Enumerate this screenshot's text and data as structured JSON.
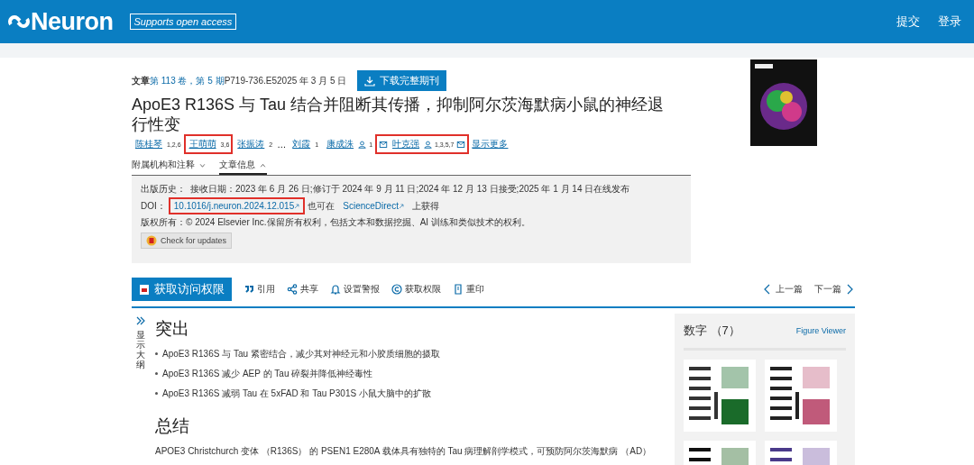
{
  "header": {
    "logo": "Neuron",
    "badge": "Supports open access",
    "actions": [
      "提交",
      "登录"
    ]
  },
  "article": {
    "meta_label": "文章",
    "meta_issue": "第 113 卷，第 5 期",
    "meta_pages": "P719-736.E52025 年 3 月 5 日",
    "download": "下载完整期刊",
    "title": "ApoE3 R136S 与 Tau 结合并阻断其传播，抑制阿尔茨海默病小鼠的神经退行性变",
    "authors": [
      {
        "name": "陈桂琴",
        "sup": "1,2,6",
        "highlighted": false,
        "person": false,
        "mail_before": false,
        "mail_after": false
      },
      {
        "name": "王萌萌",
        "sup": "3,6",
        "highlighted": true,
        "person": false,
        "mail_before": false,
        "mail_after": false
      },
      {
        "name": "张振涛",
        "sup": "2",
        "highlighted": false,
        "person": false,
        "mail_before": false,
        "mail_after": false
      },
      {
        "name": "刘霞",
        "sup": "1",
        "highlighted": false,
        "person": false,
        "mail_before": false,
        "mail_after": false,
        "ellipsis_before": "…"
      },
      {
        "name": "康成洙",
        "sup": "1",
        "highlighted": false,
        "person": true,
        "mail_before": false,
        "mail_after": false
      },
      {
        "name": "叶克强",
        "sup": "1,3,5,7",
        "highlighted": true,
        "person": true,
        "mail_before": true,
        "mail_after": true
      }
    ],
    "show_more": "显示更多",
    "info_tabs": [
      {
        "label": "附属机构和注释",
        "expanded": false
      },
      {
        "label": "文章信息",
        "expanded": true
      }
    ],
    "history_label": "出版历史：",
    "history": "接收日期：2023 年 6 月 26 日;修订于 2024 年 9 月 11 日;2024 年 12 月 13 日接受;2025 年 1 月 14 日在线发布",
    "doi_label": "DOI：",
    "doi": "10.1016/j.neuron.2024.12.015",
    "doi_highlighted": true,
    "also": "也可在",
    "sd": "ScienceDirect",
    "also_after": "上获得",
    "copyright": "版权所有：© 2024 Elsevier Inc.保留所有权利，包括文本和数据挖掘、AI 训练和类似技术的权利。",
    "updates": "Check for updates"
  },
  "toolbar": {
    "access": "获取访问权限",
    "items": [
      {
        "kind": "quote",
        "label": "引用"
      },
      {
        "kind": "share",
        "label": "共享"
      },
      {
        "kind": "bell",
        "label": "设置警报"
      },
      {
        "kind": "copyright",
        "label": "获取权限"
      },
      {
        "kind": "reprint",
        "label": "重印"
      }
    ],
    "prev": "上一篇",
    "next": "下一篇"
  },
  "outline": {
    "label": "显示大纲"
  },
  "highlights": {
    "heading": "突出",
    "items": [
      "ApoE3 R136S 与 Tau 紧密结合，减少其对神经元和小胶质细胞的摄取",
      "ApoE3 R136S 减少 AEP 的 Tau 碎裂并降低神经毒性",
      "ApoE3 R136S 减弱 Tau 在 5xFAD 和 Tau P301S 小鼠大脑中的扩散"
    ]
  },
  "summary": {
    "heading": "总结",
    "text": "APOE3 Christchurch 变体 （R136S） 的 PSEN1 E280A 载体具有独特的 Tau 病理解剖学模式，可预防阿尔茨海默病 （AD）"
  },
  "figures": {
    "title": "数字 （7）",
    "viewer": "Figure Viewer"
  }
}
